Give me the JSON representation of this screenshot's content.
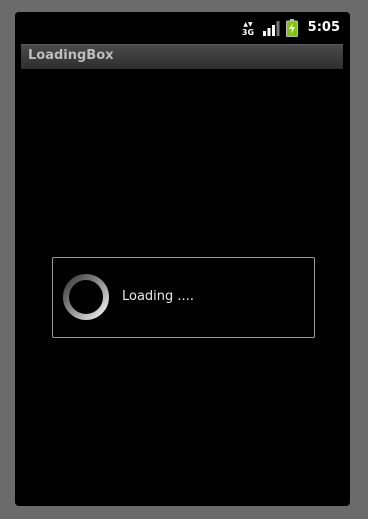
{
  "status_bar": {
    "network_label_top": "▲▼",
    "network_label": "3G",
    "time": "5:05"
  },
  "app": {
    "title": "LoadingBox"
  },
  "dialog": {
    "message": "Loading ...."
  },
  "colors": {
    "background": "#000000",
    "battery_fill": "#7dc800",
    "frame": "#6b6b6b"
  }
}
